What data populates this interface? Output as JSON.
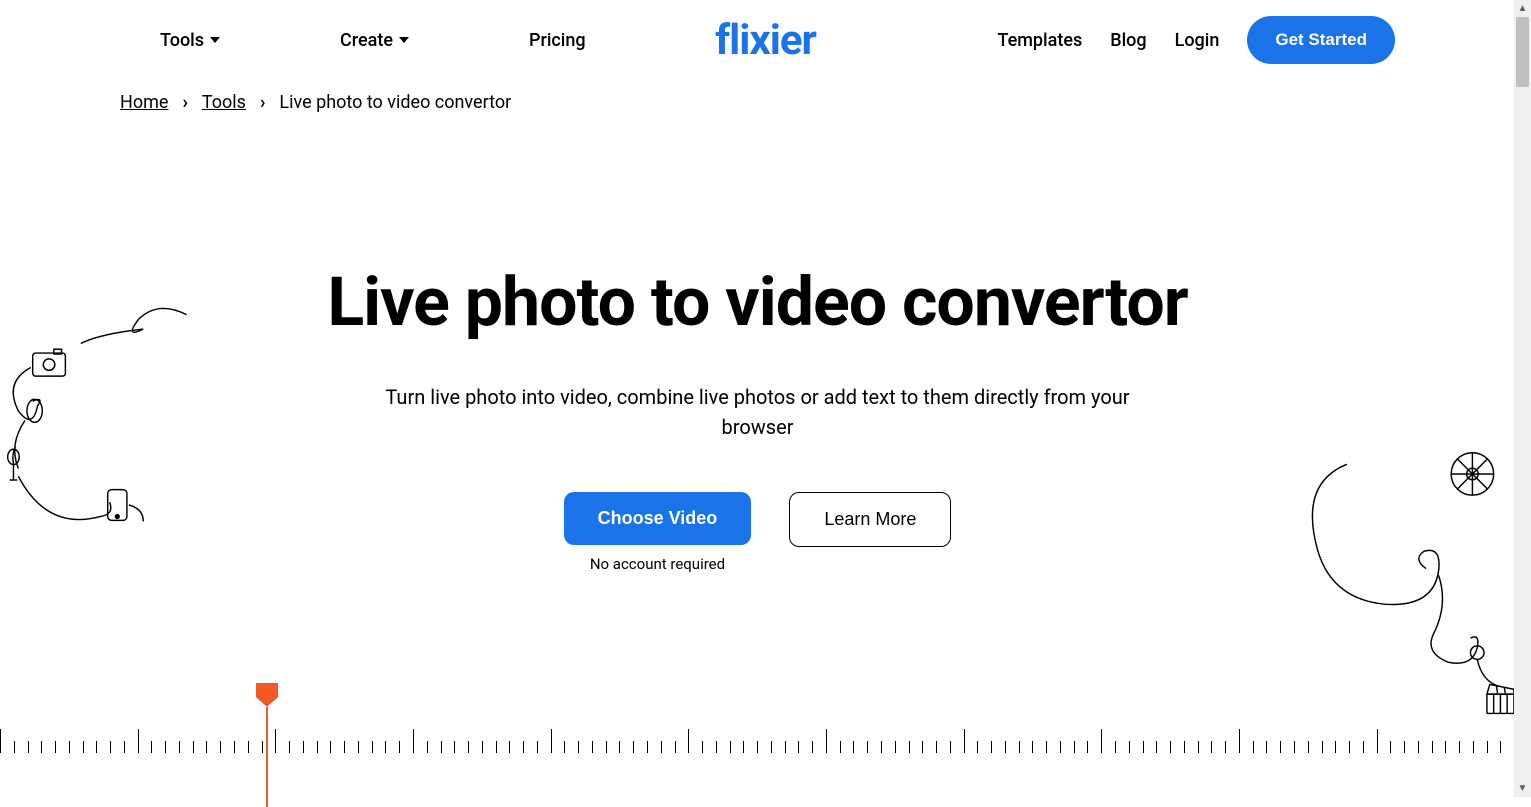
{
  "header": {
    "nav_left": {
      "tools": "Tools",
      "create": "Create",
      "pricing": "Pricing"
    },
    "logo": "flixier",
    "nav_right": {
      "templates": "Templates",
      "blog": "Blog",
      "login": "Login",
      "get_started": "Get Started"
    }
  },
  "breadcrumb": {
    "home": "Home",
    "tools": "Tools",
    "current": "Live photo to video convertor"
  },
  "hero": {
    "title": "Live photo to video convertor",
    "subtitle": "Turn live photo into video, combine live photos or add text to them directly from your browser",
    "cta_primary": "Choose Video",
    "cta_note": "No account required",
    "cta_secondary": "Learn More"
  },
  "colors": {
    "primary": "#1a73e8",
    "accent": "#f15a24"
  }
}
